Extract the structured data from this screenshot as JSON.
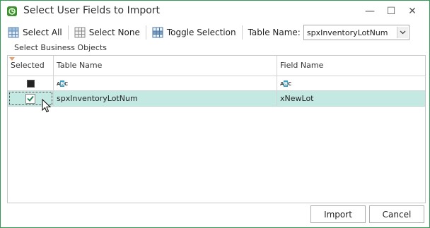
{
  "window": {
    "title": "Select User Fields to Import",
    "controls": {
      "minimize": "—",
      "maximize": "☐",
      "close": "✕"
    }
  },
  "toolbar": {
    "select_all_label": "Select All",
    "select_none_label": "Select None",
    "toggle_selection_label": "Toggle Selection",
    "table_name_label": "Table Name:",
    "table_name_value": "spxInventoryLotNum"
  },
  "group": {
    "label": "Select Business Objects"
  },
  "grid": {
    "columns": [
      "Selected",
      "Table Name",
      "Field Name"
    ],
    "filter_glyph": "A B C",
    "rows": [
      {
        "selected": true,
        "table_name": "spxInventoryLotNum",
        "field_name": "xNewLot"
      }
    ]
  },
  "footer": {
    "import_label": "Import",
    "cancel_label": "Cancel"
  },
  "colors": {
    "accent_border": "#2f9b53",
    "selected_row": "#c4e9e3",
    "checkmark": "#1a7f4a"
  }
}
